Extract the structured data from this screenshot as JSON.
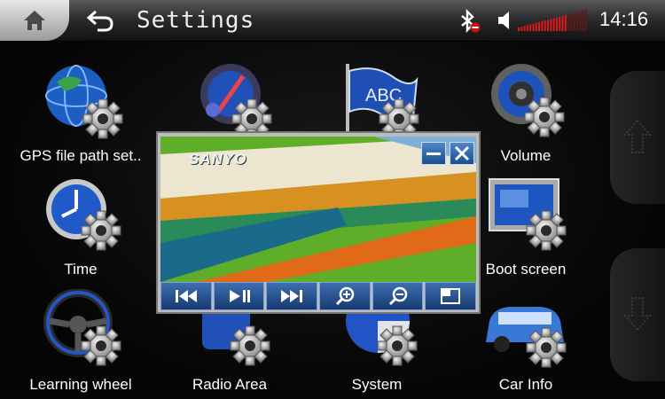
{
  "header": {
    "title": "Settings",
    "time": "14:16"
  },
  "status": {
    "bluetooth": "bluetooth-off",
    "volume_level": 0.7
  },
  "grid": {
    "items": [
      {
        "label": "GPS file path set..",
        "icon": "globe-gear-icon"
      },
      {
        "label": "",
        "icon": "navigation-gear-icon"
      },
      {
        "label": "",
        "icon": "language-flag-gear-icon"
      },
      {
        "label": "Volume",
        "icon": "speaker-gear-icon"
      },
      {
        "label": "Time",
        "icon": "clock-gear-icon"
      },
      {
        "label": "Boot screen",
        "icon": "monitor-gear-icon"
      },
      {
        "label": "Learning wheel",
        "icon": "steering-wheel-gear-icon"
      },
      {
        "label": "Radio Area",
        "icon": "radio-gear-icon"
      },
      {
        "label": "System",
        "icon": "system-gear-icon"
      },
      {
        "label": "Car Info",
        "icon": "car-gear-icon"
      }
    ]
  },
  "video_popup": {
    "brand": "SANYO",
    "controls": [
      "previous",
      "play-pause",
      "next",
      "zoom-in",
      "zoom-out",
      "fullscreen"
    ]
  },
  "colors": {
    "accent": "#2a6fd0",
    "topbar": "#2c2c2c"
  }
}
